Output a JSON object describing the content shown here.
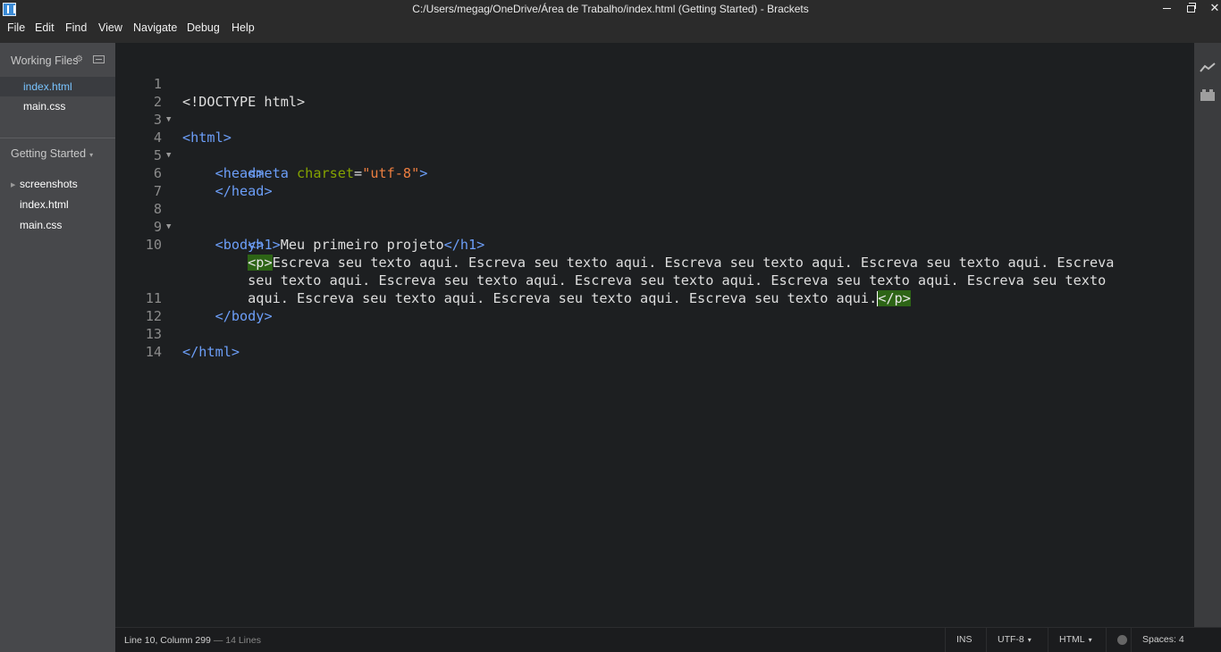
{
  "window": {
    "title": "C:/Users/megag/OneDrive/Área de Trabalho/index.html (Getting Started) - Brackets",
    "minimize_glyph": "minimize",
    "close_glyph": "✕"
  },
  "menu": [
    "File",
    "Edit",
    "Find",
    "View",
    "Navigate",
    "Debug",
    "Help"
  ],
  "sidebar": {
    "working_files_label": "Working Files",
    "working_files": [
      {
        "name": "index.html",
        "active": true
      },
      {
        "name": "main.css",
        "active": false
      }
    ],
    "project_name": "Getting Started",
    "project_caret": "▾",
    "tree_arrow": "▶",
    "tree": [
      "screenshots",
      "index.html",
      "main.css"
    ]
  },
  "editor": {
    "line_numbers": [
      "1",
      "2",
      "3",
      "4",
      "5",
      "6",
      "7",
      "8",
      "9",
      "10",
      "",
      "",
      "11",
      "12",
      "13",
      "14"
    ],
    "fold_marker": "▼",
    "doctype": "<!DOCTYPE html>",
    "html_open": "<html>",
    "head_open": "<head>",
    "meta_open": "<meta",
    "meta_attr": "charset",
    "meta_eq": "=",
    "meta_val": "\"utf-8\"",
    "meta_close": ">",
    "head_close": "</head>",
    "body_open": "<body>",
    "h1_open": "<h1>",
    "h1_text": "Meu primeiro projeto",
    "h1_close": "</h1>",
    "p_open": "<p>",
    "p_line1": "Escreva seu texto aqui. Escreva seu texto aqui. Escreva seu texto aqui. Escreva seu texto aqui. Escreva",
    "p_line2": "seu texto aqui. Escreva seu texto aqui. Escreva seu texto aqui. Escreva seu texto aqui. Escreva seu texto",
    "p_line3": "aqui. Escreva seu texto aqui. Escreva seu texto aqui. Escreva seu texto aqui.",
    "p_close": "</p>",
    "body_close": "</body>",
    "html_close": "</html>"
  },
  "statusbar": {
    "position": "Line 10, Column 299",
    "lines": " — 14 Lines",
    "mode": "INS",
    "encoding": "UTF-8",
    "language": "HTML",
    "indent": "Spaces: 4",
    "caret": "▾"
  },
  "colors": {
    "background": "#1d1f21",
    "sidebar": "#47484b",
    "tag": "#6c9ef8",
    "attribute": "#85a300",
    "string": "#ec7e40",
    "bracket_match": "#2d6416",
    "active_file": "#79c4ff"
  }
}
